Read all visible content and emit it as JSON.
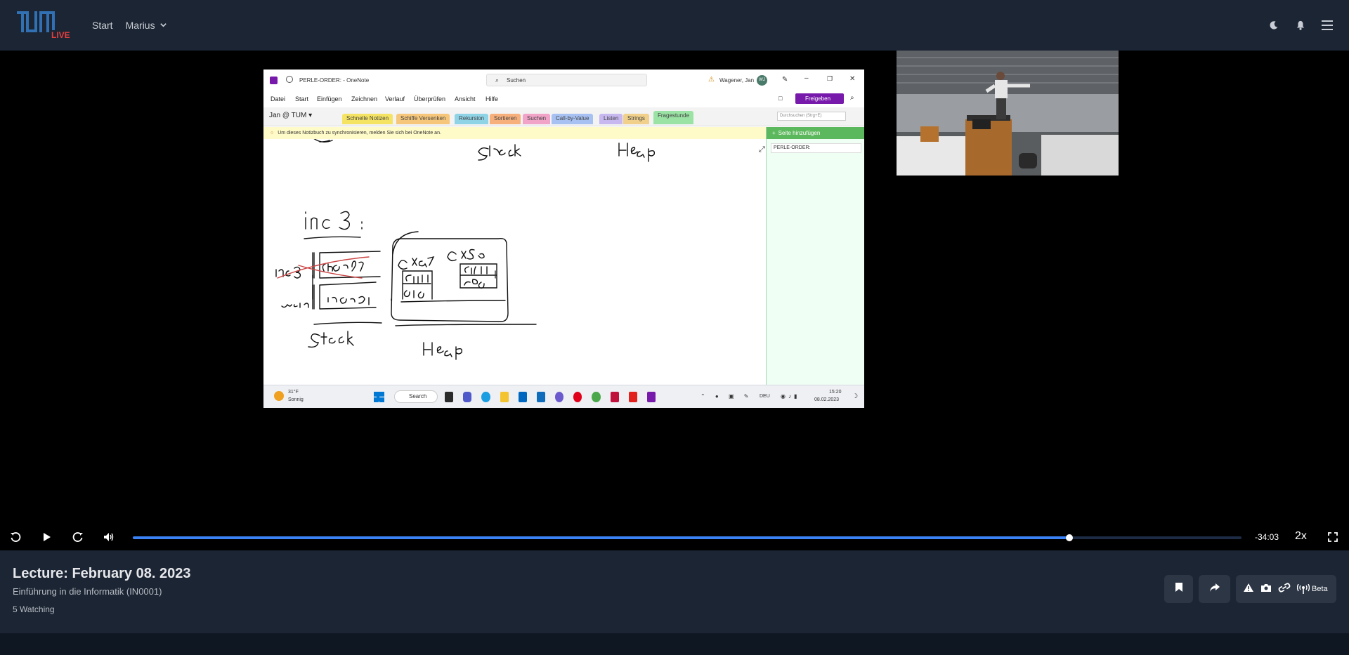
{
  "nav": {
    "logo_text": "TUM",
    "logo_badge": "LIVE",
    "start": "Start",
    "user": "Marius"
  },
  "onenote": {
    "title": "PERLE-ORDER: - OneNote",
    "search_placeholder": "Suchen",
    "user_name": "Wagener, Jan",
    "user_initials": "WJ",
    "menu": [
      "Datei",
      "Start",
      "Einfügen",
      "Zeichnen",
      "Verlauf",
      "Überprüfen",
      "Ansicht",
      "Hilfe"
    ],
    "share": "Freigeben",
    "notebook": "Jan @ TUM",
    "tabs": [
      {
        "label": "Schnelle Notizen",
        "color": "#f5e463"
      },
      {
        "label": "Schiffe Versenken",
        "color": "#f6c77b"
      },
      {
        "label": "Rekursion",
        "color": "#8fd3e6"
      },
      {
        "label": "Sortieren",
        "color": "#f7b07c"
      },
      {
        "label": "Suchen",
        "color": "#f2a3c8"
      },
      {
        "label": "Call-by-Value",
        "color": "#a7c1f2"
      },
      {
        "label": "Listen",
        "color": "#c7b8f0"
      },
      {
        "label": "Strings",
        "color": "#f0d08a"
      },
      {
        "label": "Fragestunde",
        "color": "#9be3a5"
      }
    ],
    "section_search": "Durchsuchen (Strg+E)",
    "banner": "Um dieses Notizbuch zu synchronisieren, melden Sie sich bei OneNote an.",
    "add_page": "Seite hinzufügen",
    "page_name": "PERLE-ORDER:",
    "weather_temp": "31°F",
    "weather_desc": "Sonnig",
    "task_search": "Search",
    "lang": "DEU",
    "clock_time": "15:20",
    "clock_date": "08.02.2023"
  },
  "player": {
    "progress": 0.845,
    "time_remaining": "-34:03",
    "speed": "2x"
  },
  "lecture": {
    "title": "Lecture: February 08. 2023",
    "course": "Einführung in die Informatik (IN0001)",
    "watching": "5 Watching",
    "beta": "Beta"
  }
}
